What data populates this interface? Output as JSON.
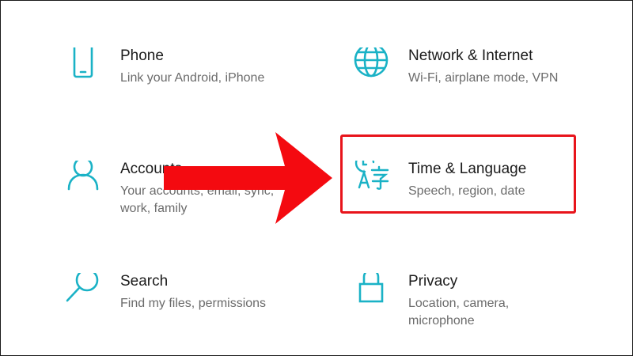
{
  "accent_color": "#1ab2c6",
  "highlight_color": "#e8141b",
  "tiles": {
    "phone": {
      "title": "Phone",
      "description": "Link your Android, iPhone",
      "icon": "phone-icon"
    },
    "network": {
      "title": "Network & Internet",
      "description": "Wi-Fi, airplane mode, VPN",
      "icon": "globe-icon"
    },
    "accounts": {
      "title": "Accounts",
      "description": "Your accounts, email, sync, work, family",
      "icon": "person-icon"
    },
    "time_language": {
      "title": "Time & Language",
      "description": "Speech, region, date",
      "icon": "time-language-icon"
    },
    "search": {
      "title": "Search",
      "description": "Find my files, permissions",
      "icon": "magnifier-icon"
    },
    "privacy": {
      "title": "Privacy",
      "description": "Location, camera, microphone",
      "icon": "lock-icon"
    }
  },
  "annotation": {
    "arrow": "red-arrow-icon",
    "highlighted_tile": "time_language"
  }
}
